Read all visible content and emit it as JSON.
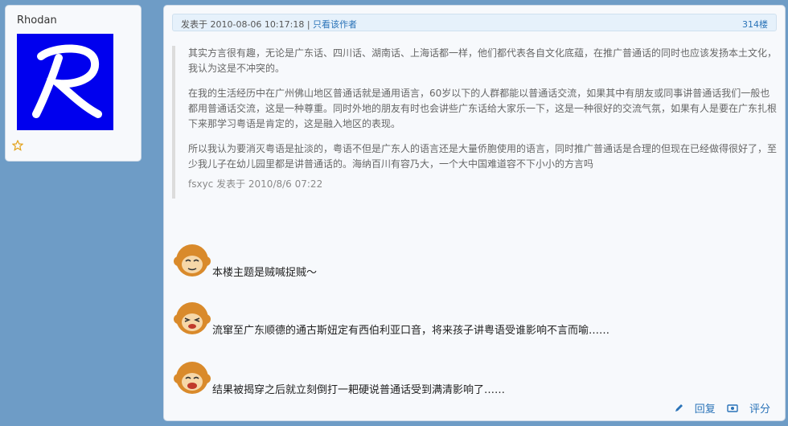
{
  "user": {
    "name": "Rhodan",
    "avatar_letter": "R",
    "avatar_bg": "#0000ee",
    "star_icon": "star-outline-icon"
  },
  "post": {
    "header": {
      "posted_prefix": "发表于",
      "timestamp": "2010-08-06 10:17:18",
      "separator": "|",
      "only_author_label": "只看该作者",
      "floor": "314楼"
    },
    "quote": {
      "paragraphs": [
        "其实方言很有趣，无论是广东话、四川话、湖南话、上海话都一样，他们都代表各自文化底蕴，在推广普通话的同时也应该发扬本土文化，我认为这是不冲突的。",
        "在我的生活经历中在广州佛山地区普通话就是通用语言，60岁以下的人群都能以普通话交流，如果其中有朋友或同事讲普通话我们一般也都用普通话交流，这是一种尊重。同时外地的朋友有时也会讲些广东话给大家乐一下，这是一种很好的交流气氛，如果有人是要在广东扎根下来那学习粤语是肯定的，这是融入地区的表现。",
        "所以我认为要消灭粤语是扯淡的，粤语不但是广东人的语言还是大量侨胞使用的语言，同时推广普通话是合理的但现在已经做得很好了，至少我儿子在幼儿园里都是讲普通话的。海纳百川有容乃大，一个大中国难道容不下小小的方言吗"
      ],
      "footer": "fsxyc 发表于 2010/8/6 07:22"
    },
    "lines": [
      "本楼主题是贼喊捉贼～",
      "流窜至广东顺德的通古斯妞定有西伯利亚口音，将来孩子讲粤语受谁影响不言而喻……",
      "结果被揭穿之后就立刻倒打一耙硬说普通话受到满清影响了……"
    ],
    "actions": {
      "reply_label": "回复",
      "rate_label": "评分"
    }
  }
}
